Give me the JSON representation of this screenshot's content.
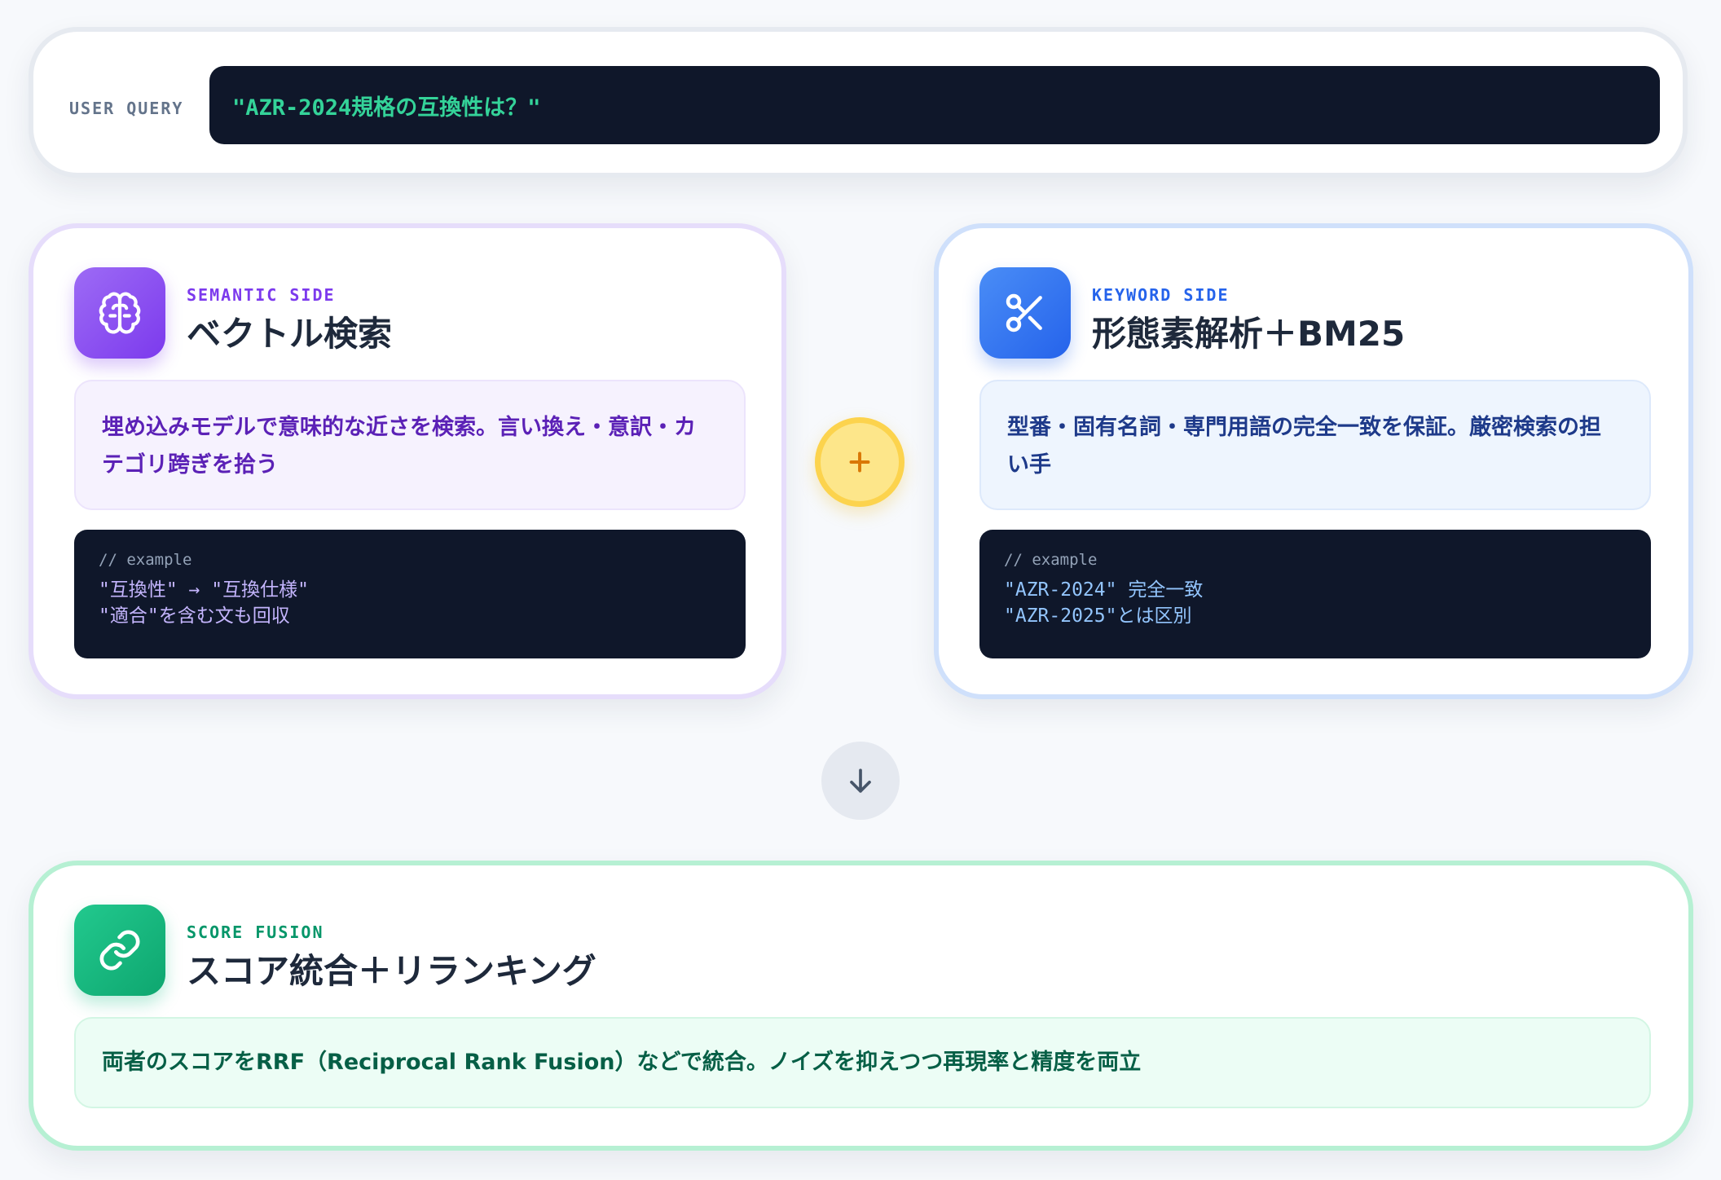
{
  "query": {
    "label": "USER QUERY",
    "text": "\"AZR-2024規格の互換性は？\""
  },
  "semantic": {
    "tag": "SEMANTIC SIDE",
    "title": "ベクトル検索",
    "desc_line1": "埋め込みモデルで意味的な近さを検索。言い換え・意訳・カ",
    "desc_line2": "テゴリ跨ぎを拾う",
    "code_comment": "// example",
    "code_line1": "\"互換性\" → \"互換仕様\"",
    "code_line2": "\"適合\"を含む文も回収",
    "icon": "brain-icon",
    "accent": "#7c3aed"
  },
  "keyword": {
    "tag": "KEYWORD SIDE",
    "title": "形態素解析＋BM25",
    "desc_line1": "型番・固有名詞・専門用語の完全一致を保証。厳密検索の担",
    "desc_line2": "い手",
    "code_comment": "// example",
    "code_line1": "\"AZR-2024\" 完全一致",
    "code_line2": "\"AZR-2025\"とは区別",
    "icon": "scissors-icon",
    "accent": "#2563eb"
  },
  "combine": {
    "icon": "plus-icon",
    "accent": "#d97706"
  },
  "flow": {
    "icon": "arrow-down-icon"
  },
  "fusion": {
    "tag": "SCORE FUSION",
    "title": "スコア統合＋リランキング",
    "desc": "両者のスコアをRRF（Reciprocal Rank Fusion）などで統合。ノイズを抑えつつ再現率と精度を両立",
    "icon": "link-icon",
    "accent": "#10b981"
  }
}
